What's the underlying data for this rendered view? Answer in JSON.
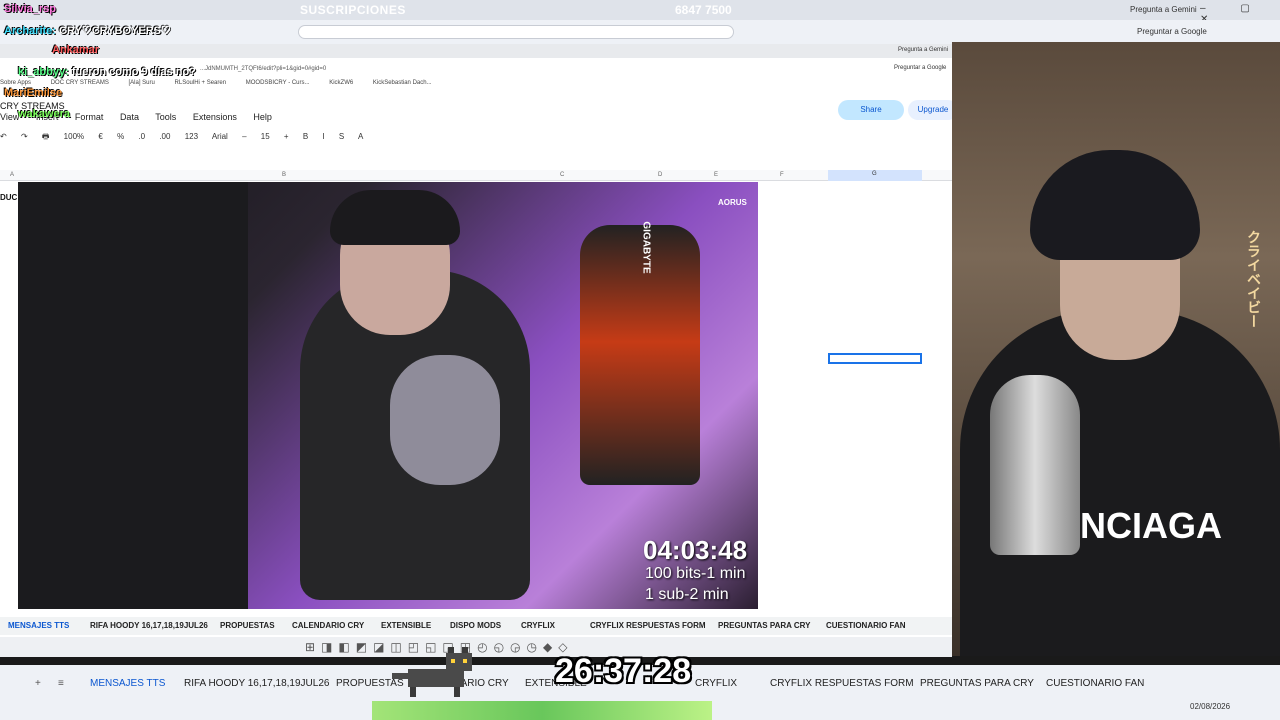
{
  "top": {
    "title": "SUSCRIPCIONES",
    "sub_count": "6847 7500",
    "gemini": "Pregunta a Gemini",
    "gemini_google": "Preguntar a Google",
    "window_controls": "– ▢ ✕"
  },
  "inner": {
    "url": "...JdNMUMTH_2TQFt6/edit?pli=1&gid=0#gid=0",
    "gemini_google": "Preguntar a Google",
    "gemini": "Pregunta a Gemini",
    "bookmarks": [
      "Sobre Apps",
      "DOC CRY STREAMS",
      "[Ala] Suru",
      "RLSoulHi + Searen",
      "MOODSBICRY - Curs...",
      "KickZW6",
      "KickSebastian Dach..."
    ],
    "doc_title": "CRY STREAMS",
    "menus": [
      "View",
      "Insert",
      "Format",
      "Data",
      "Tools",
      "Extensions",
      "Help"
    ],
    "share": "Share",
    "upgrade": "Upgrade",
    "toolbar": [
      "↶",
      "↷",
      "🖶",
      "100%",
      "€",
      "%",
      ".0",
      ".00",
      "123",
      "Arial",
      "–",
      "15",
      "+",
      "B",
      "I",
      "S",
      "A"
    ],
    "columns": [
      "A",
      "B",
      "C",
      "D",
      "E",
      "F",
      "G"
    ],
    "cell_label": "DUC"
  },
  "video": {
    "timer": "04:03:48",
    "bits": "100 bits-1 min",
    "subs": "1 sub-2 min",
    "brand1": "GIGABYTE",
    "brand2": "AORUS"
  },
  "chat": [
    {
      "user": "Silvia_rsp",
      "color": "#ff7ae0"
    },
    {
      "user": "Archarite",
      "msg": "CRY♡CRYBOYERS♡",
      "color": "#40e0ff"
    },
    {
      "user": "Ankamar",
      "color": "#ff5a5a"
    },
    {
      "user": "ki_abbyy",
      "msg": "fueron como 9 días no?",
      "color": "#5aff8a"
    },
    {
      "user": "MariEmilse",
      "color": "#ff9a3c"
    },
    {
      "user": "wakawera",
      "color": "#7aff5a"
    }
  ],
  "sheet_tabs": [
    "MENSAJES TTS",
    "RIFA HOODY 16,17,18,19JUL26",
    "PROPUESTAS",
    "CALENDARIO CRY",
    "EXTENSIBLE",
    "DISPO MODS",
    "CRYFLIX",
    "CRYFLIX RESPUESTAS FORM",
    "PREGUNTAS PARA CRY",
    "CUESTIONARIO FAN"
  ],
  "outer_tabs": [
    "MENSAJES TTS",
    "RIFA HOODY 16,17,18,19JUL26",
    "PROPUESTAS",
    "CALENDARIO CRY",
    "EXTENSIBLE",
    "CRYFLIX",
    "CRYFLIX RESPUESTAS FORM",
    "PREGUNTAS PARA CRY",
    "CUESTIONARIO FAN"
  ],
  "big_timer": "26:37:28",
  "webcam": {
    "brand": "NCIAGA",
    "jp": "クライベイビー"
  },
  "tray": "02/08/2026"
}
